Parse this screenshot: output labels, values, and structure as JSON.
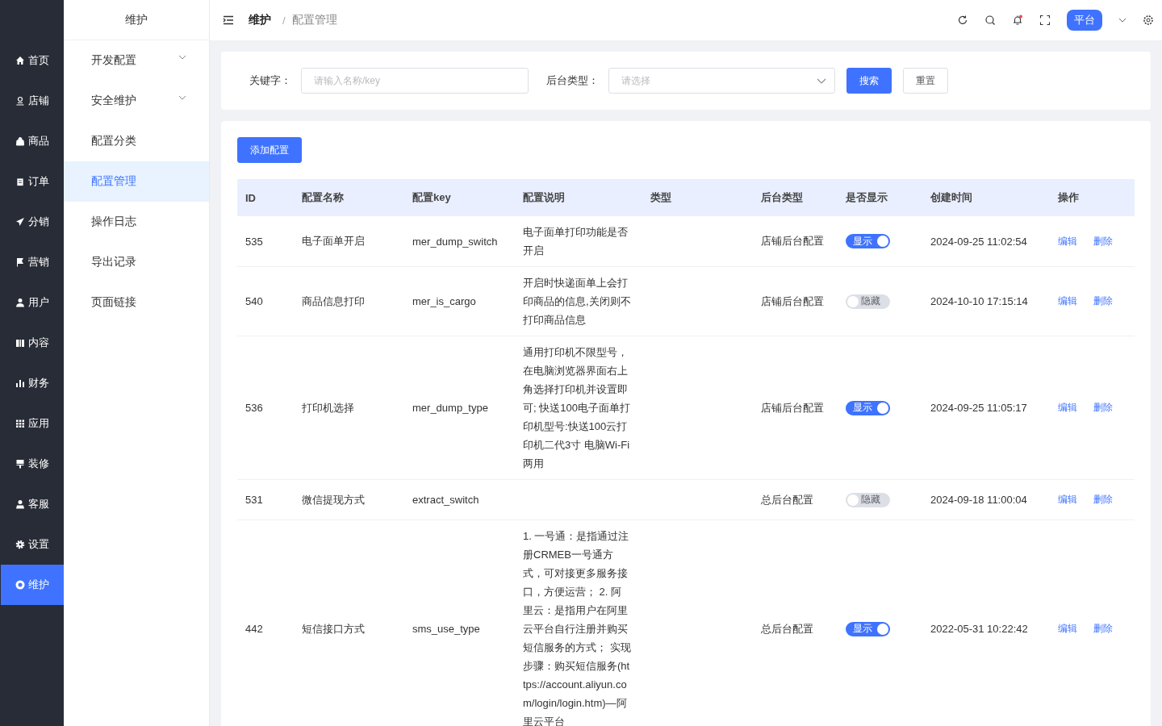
{
  "main_menu": [
    {
      "label": "首页",
      "selected": false
    },
    {
      "label": "店铺",
      "selected": false
    },
    {
      "label": "商品",
      "selected": false
    },
    {
      "label": "订单",
      "selected": false
    },
    {
      "label": "分销",
      "selected": false
    },
    {
      "label": "营销",
      "selected": false
    },
    {
      "label": "用户",
      "selected": false
    },
    {
      "label": "内容",
      "selected": false
    },
    {
      "label": "财务",
      "selected": false
    },
    {
      "label": "应用",
      "selected": false
    },
    {
      "label": "装修",
      "selected": false
    },
    {
      "label": "客服",
      "selected": false
    },
    {
      "label": "设置",
      "selected": false
    },
    {
      "label": "维护",
      "selected": true
    }
  ],
  "sub_menu": {
    "title": "维护",
    "items": [
      {
        "label": "开发配置",
        "expandable": true,
        "selected": false
      },
      {
        "label": "安全维护",
        "expandable": true,
        "selected": false
      },
      {
        "label": "配置分类",
        "expandable": false,
        "selected": false
      },
      {
        "label": "配置管理",
        "expandable": false,
        "selected": true
      },
      {
        "label": "操作日志",
        "expandable": false,
        "selected": false
      },
      {
        "label": "导出记录",
        "expandable": false,
        "selected": false
      },
      {
        "label": "页面链接",
        "expandable": false,
        "selected": false
      }
    ]
  },
  "breadcrumb": {
    "items": [
      "维护",
      "配置管理"
    ],
    "separator": "/"
  },
  "header": {
    "platform_button": "平台",
    "notification_dot": true
  },
  "filters": {
    "keyword_label": "关键字：",
    "keyword_placeholder": "请输入名称/key",
    "type_label": "后台类型：",
    "type_placeholder": "请选择",
    "search_button": "搜索",
    "reset_button": "重置"
  },
  "add_button": "添加配置",
  "table": {
    "columns": [
      "ID",
      "配置名称",
      "配置key",
      "配置说明",
      "类型",
      "后台类型",
      "是否显示",
      "创建时间",
      "操作"
    ],
    "rows": [
      {
        "id": "535",
        "name": "电子面单开启",
        "key": "mer_dump_switch",
        "description": "电子面单打印功能是否开启",
        "backend": "店铺后台配置",
        "on": true,
        "switch_label": "显示",
        "created": "2024-09-25 11:02:54",
        "actions": [
          "编辑",
          "删除"
        ]
      },
      {
        "id": "540",
        "name": "商品信息打印",
        "key": "mer_is_cargo",
        "description": "开启时快递面单上会打印商品的信息,关闭则不打印商品信息",
        "backend": "店铺后台配置",
        "on": false,
        "switch_label": "隐藏",
        "created": "2024-10-10 17:15:14",
        "actions": [
          "编辑",
          "删除"
        ]
      },
      {
        "id": "536",
        "name": "打印机选择",
        "key": "mer_dump_type",
        "description": "通用打印机不限型号，在电脑浏览器界面右上角选择打印机并设置即可; 快送100电子面单打印机型号:快送100云打印机二代3寸 电脑Wi-Fi两用",
        "backend": "店铺后台配置",
        "on": true,
        "switch_label": "显示",
        "created": "2024-09-25 11:05:17",
        "actions": [
          "编辑",
          "删除"
        ]
      },
      {
        "id": "531",
        "name": "微信提现方式",
        "key": "extract_switch",
        "backend": "总后台配置",
        "on": false,
        "switch_label": "隐藏",
        "created": "2024-09-18 11:00:04",
        "actions": [
          "编辑",
          "删除"
        ]
      },
      {
        "id": "442",
        "name": "短信接口方式",
        "key": "sms_use_type",
        "description": "1. 一号通：是指通过注册CRMEB一号通方式，可对接更多服务接口，方便运营； 2. 阿里云：是指用户在阿里云平台自行注册并购买短信服务的方式； 实现步骤：购买短信服务(https://account.aliyun.com/login/login.htm)—阿里云平台",
        "backend": "总后台配置",
        "on": true,
        "switch_label": "显示",
        "created": "2022-05-31 10:22:42",
        "actions": [
          "编辑",
          "删除"
        ]
      }
    ]
  }
}
